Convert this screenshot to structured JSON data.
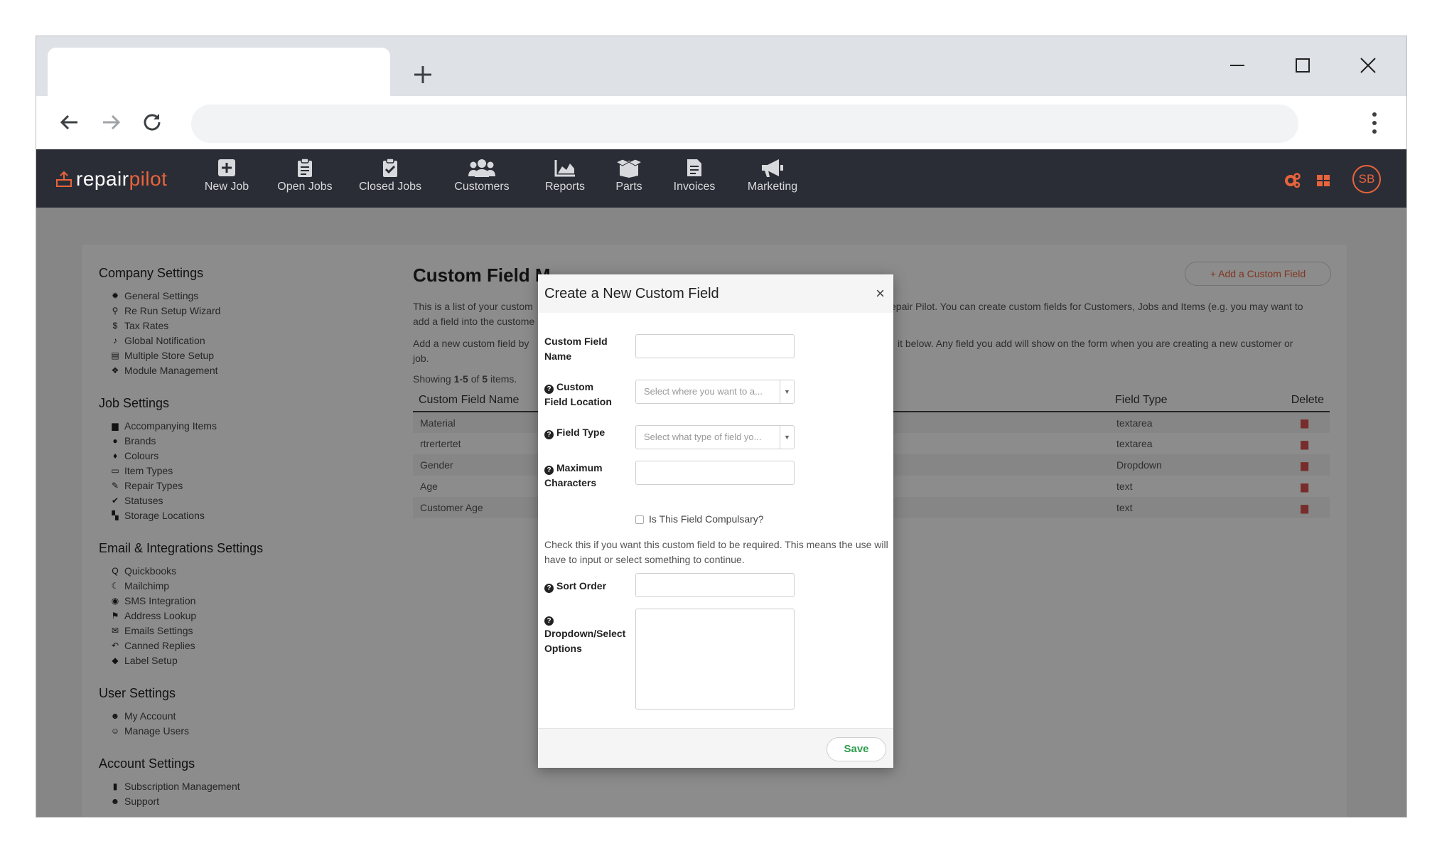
{
  "browser": {
    "new_tab_icon": "plus-icon"
  },
  "app": {
    "logo_part1": "repair",
    "logo_part2": "pilot",
    "brand_color": "#e8643b",
    "nav": [
      {
        "label": "New Job",
        "icon": "plus-square-icon"
      },
      {
        "label": "Open Jobs",
        "icon": "clipboard-icon"
      },
      {
        "label": "Closed Jobs",
        "icon": "clipboard-check-icon"
      },
      {
        "label": "Customers",
        "icon": "users-icon"
      },
      {
        "label": "Reports",
        "icon": "chart-area-icon"
      },
      {
        "label": "Parts",
        "icon": "box-open-icon"
      },
      {
        "label": "Invoices",
        "icon": "file-invoice-icon"
      },
      {
        "label": "Marketing",
        "icon": "bullhorn-icon"
      }
    ],
    "avatar_initials": "SB"
  },
  "sidebar": {
    "sections": [
      {
        "title": "Company Settings",
        "items": [
          "General Settings",
          "Re Run Setup Wizard",
          "Tax Rates",
          "Global Notification",
          "Multiple Store Setup",
          "Module Management"
        ]
      },
      {
        "title": "Job Settings",
        "items": [
          "Accompanying Items",
          "Brands",
          "Colours",
          "Item Types",
          "Repair Types",
          "Statuses",
          "Storage Locations"
        ]
      },
      {
        "title": "Email & Integrations Settings",
        "items": [
          "Quickbooks",
          "Mailchimp",
          "SMS Integration",
          "Address Lookup",
          "Emails Settings",
          "Canned Replies",
          "Label Setup"
        ]
      },
      {
        "title": "User Settings",
        "items": [
          "My Account",
          "Manage Users"
        ]
      },
      {
        "title": "Account Settings",
        "items": [
          "Subscription Management",
          "Support"
        ]
      }
    ]
  },
  "main": {
    "title": "Custom Field M",
    "add_button": "+ Add a Custom Field",
    "desc1": "This is a list of your custom",
    "desc1b": "epair Pilot. You can create custom fields for Customers, Jobs and Items (e.g. you may want to",
    "desc1c": "add a field into the custome",
    "desc2": "Add a new custom field by",
    "desc2b": "it below. Any field you add will show on the form when you are creating a new customer or",
    "desc2c": "job.",
    "showing_prefix": "Showing ",
    "showing_range": "1-5",
    "showing_mid": " of ",
    "showing_total": "5",
    "showing_suffix": " items.",
    "columns": [
      "Custom Field Name",
      "Field Type",
      "Delete"
    ],
    "rows": [
      {
        "name": "Material",
        "type": "textarea"
      },
      {
        "name": "rtrertertet",
        "type": "textarea"
      },
      {
        "name": "Gender",
        "type": "Dropdown"
      },
      {
        "name": "Age",
        "type": "text"
      },
      {
        "name": "Customer Age",
        "type": "text"
      }
    ]
  },
  "modal": {
    "title": "Create a New Custom Field",
    "close": "×",
    "name_label_1": "Custom Field",
    "name_label_2": "Name",
    "location_label_1": "Custom",
    "location_label_2": "Field Location",
    "location_placeholder": "Select where you want to a...",
    "type_label": "Field Type",
    "type_placeholder": "Select what type of field yo...",
    "max_label_1": "Maximum",
    "max_label_2": "Characters",
    "compulsory_label": "Is This Field Compulsary?",
    "help_text": "Check this if you want this custom field to be required. This means the use will have to input or select something to continue.",
    "sort_label": "Sort Order",
    "options_label_1": "Dropdown/Select",
    "options_label_2": "Options",
    "save": "Save"
  }
}
